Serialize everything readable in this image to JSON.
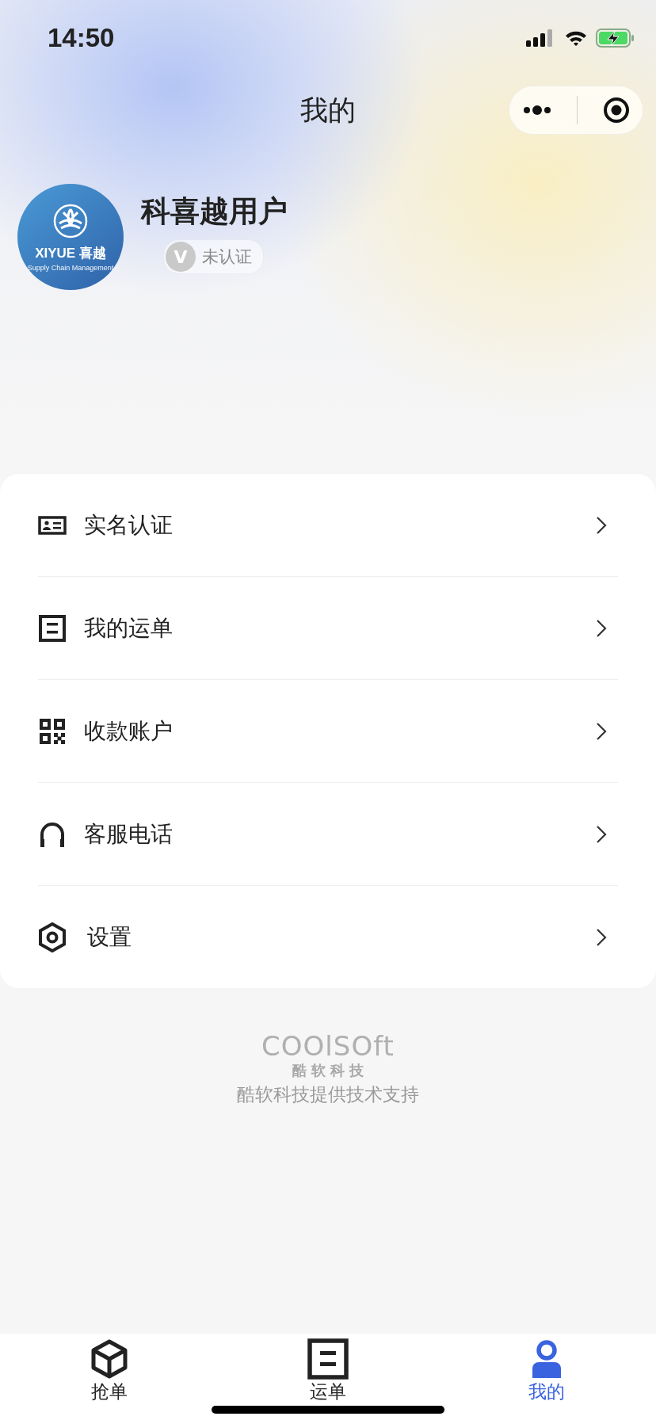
{
  "status_bar": {
    "time": "14:50"
  },
  "nav": {
    "title": "我的"
  },
  "profile": {
    "avatar_logo": "XIYUE 喜越",
    "avatar_tagline": "Supply Chain Management",
    "name": "科喜越用户",
    "verify_badge": {
      "mark": "V",
      "label": "未认证",
      "verified": false
    }
  },
  "menu": [
    {
      "kind": "id-card",
      "label": "实名认证"
    },
    {
      "kind": "document",
      "label": "我的运单"
    },
    {
      "kind": "qr",
      "label": "收款账户"
    },
    {
      "kind": "headset",
      "label": "客服电话"
    },
    {
      "kind": "settings",
      "label": "设置"
    }
  ],
  "footer": {
    "logo": "COOlSOft",
    "logo_subtitle": "酷 软 科 技",
    "support": "酷软科技提供技术支持"
  },
  "tabs": [
    {
      "kind": "box",
      "label": "抢单",
      "selected": false
    },
    {
      "kind": "document",
      "label": "运单",
      "selected": false
    },
    {
      "kind": "person",
      "label": "我的",
      "selected": true
    }
  ]
}
